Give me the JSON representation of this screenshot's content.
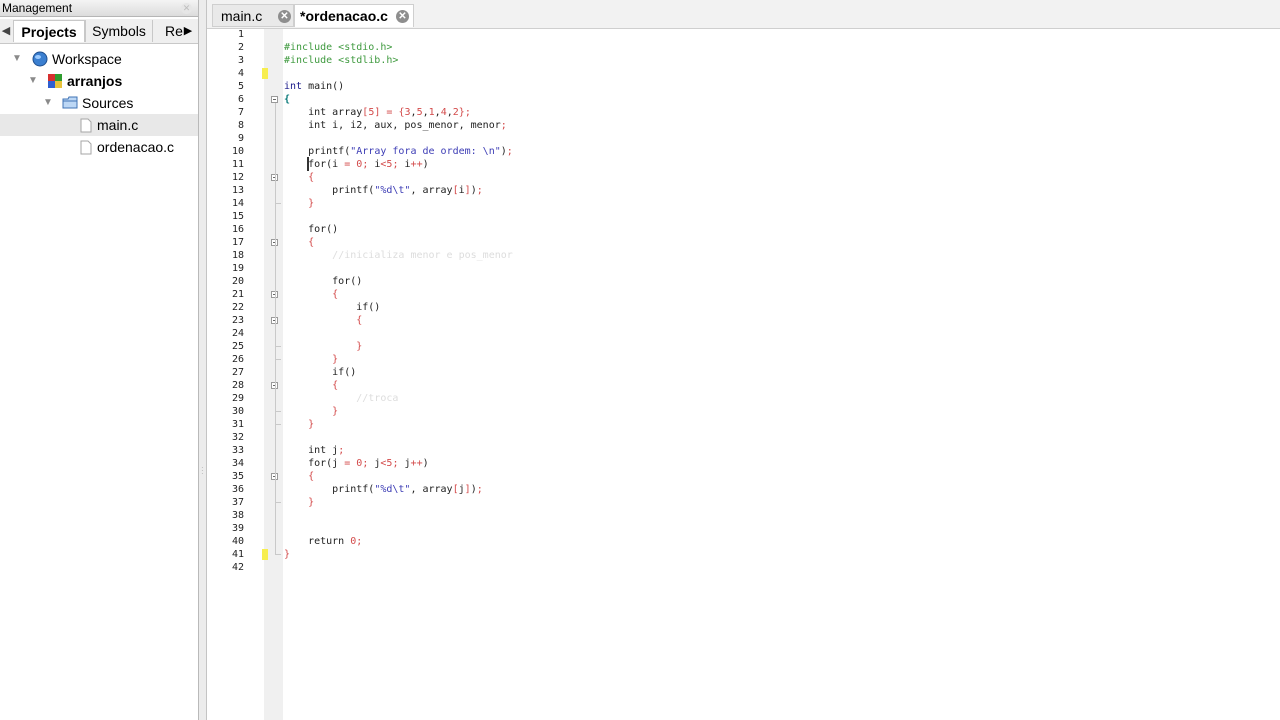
{
  "management": {
    "title": "Management",
    "tabs": [
      "Projects",
      "Symbols",
      "Re"
    ],
    "tree": [
      {
        "label": "Workspace",
        "icon": "workspace-globe-icon"
      },
      {
        "label": "arranjos",
        "icon": "project-icon"
      },
      {
        "label": "Sources",
        "icon": "folder-icon"
      },
      {
        "label": "main.c",
        "icon": "file-icon"
      },
      {
        "label": "ordenacao.c",
        "icon": "file-icon"
      }
    ]
  },
  "editor": {
    "tabs": [
      {
        "label": "main.c",
        "modified": false
      },
      {
        "label": "*ordenacao.c",
        "modified": true
      }
    ],
    "active_tab": "*ordenacao.c",
    "lines": [
      "",
      "#include <stdio.h>",
      "#include <stdlib.h>",
      "",
      "int main()",
      "{",
      "    int array[5] = {3,5,1,4,2};",
      "    int i, i2, aux, pos_menor, menor;",
      "",
      "    printf(\"Array fora de ordem: \\n\");",
      "    for(i = 0; i<5; i++)",
      "    {",
      "        printf(\"%d\\t\", array[i]);",
      "    }",
      "",
      "    for()",
      "    {",
      "        //inicializa menor e pos_menor",
      "",
      "        for()",
      "        {",
      "            if()",
      "            {",
      "",
      "            }",
      "        }",
      "        if()",
      "        {",
      "            //troca",
      "        }",
      "    }",
      "",
      "    int j;",
      "    for(j = 0; j<5; j++)",
      "    {",
      "        printf(\"%d\\t\", array[j]);",
      "    }",
      "",
      "",
      "    return 0;",
      "}",
      ""
    ]
  },
  "colors": {
    "preprocessor": "#3f9a3f",
    "keyword": "#1a1a8a",
    "operator": "#d34a4a",
    "string": "#3d3db5",
    "comment": "#dddddd",
    "change_marker": "#f7ee4f"
  }
}
